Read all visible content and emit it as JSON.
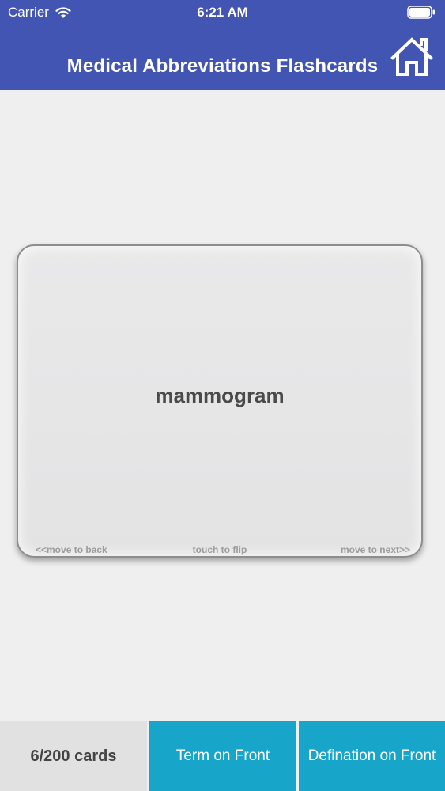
{
  "status_bar": {
    "carrier": "Carrier",
    "time": "6:21 AM"
  },
  "header": {
    "title": "Medical Abbreviations Flashcards",
    "home_icon": "home-icon"
  },
  "card": {
    "term": "mammogram",
    "hint_back": "<<move to back",
    "hint_flip": "touch to flip",
    "hint_next": "move to next>>"
  },
  "bottom_bar": {
    "count": "6/200 cards",
    "term_front_label": "Term on Front",
    "definition_front_label": "Defination on Front"
  },
  "colors": {
    "header": "#4255b3",
    "button": "#17a6c9",
    "background": "#efeff0"
  }
}
